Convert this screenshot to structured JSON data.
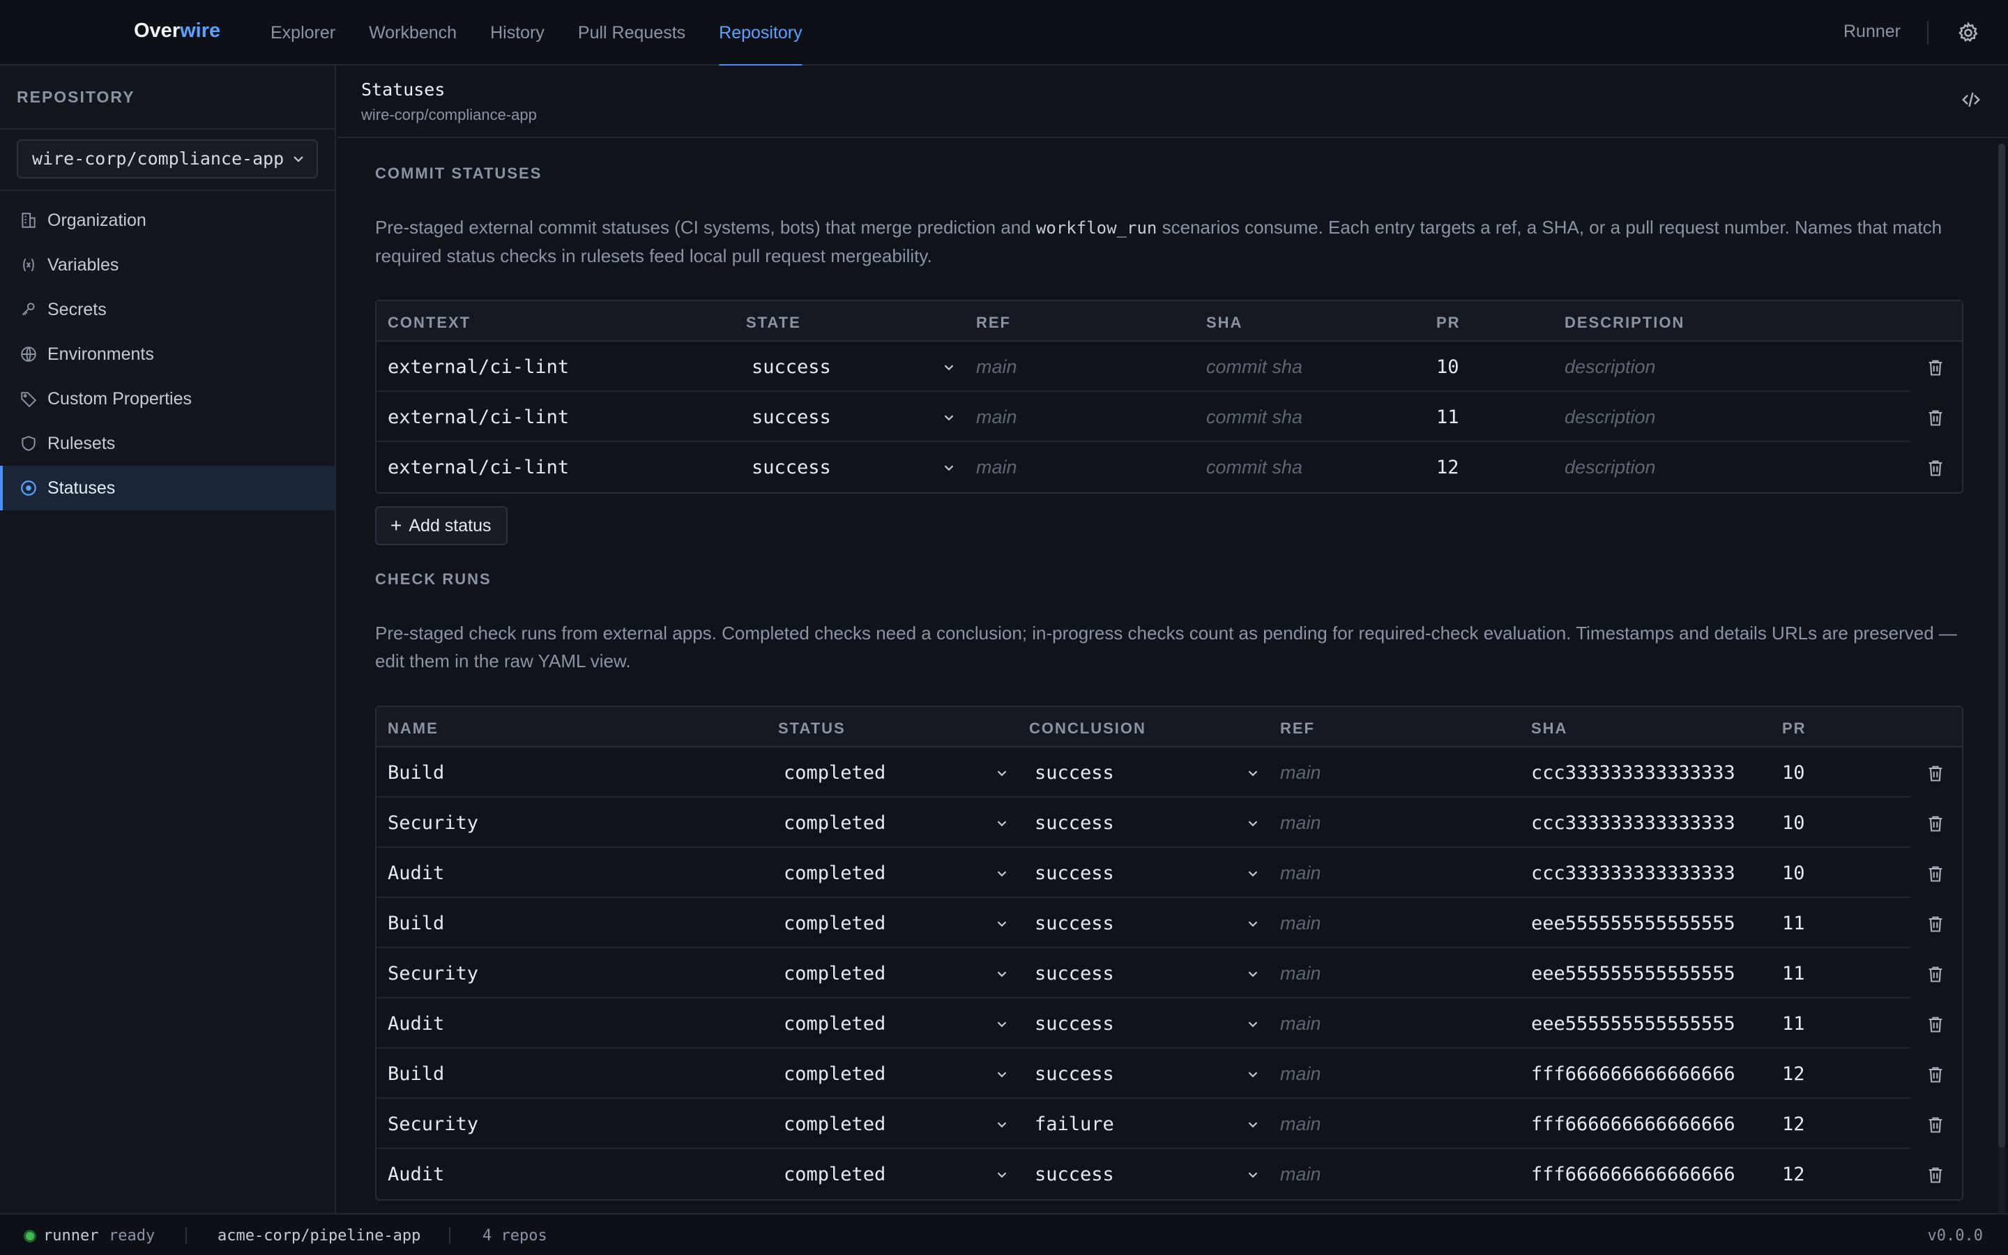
{
  "app": {
    "brand_part1": "Over",
    "brand_part2": "wire"
  },
  "nav": {
    "items": [
      "Explorer",
      "Workbench",
      "History",
      "Pull Requests",
      "Repository"
    ],
    "active": "Repository",
    "runner": "Runner"
  },
  "sidebar": {
    "heading": "REPOSITORY",
    "repo_select": "wire-corp/compliance-app",
    "items": [
      {
        "label": "Organization",
        "icon": "building-icon"
      },
      {
        "label": "Variables",
        "icon": "variable-icon"
      },
      {
        "label": "Secrets",
        "icon": "key-icon"
      },
      {
        "label": "Environments",
        "icon": "globe-icon"
      },
      {
        "label": "Custom Properties",
        "icon": "tag-icon"
      },
      {
        "label": "Rulesets",
        "icon": "shield-icon"
      },
      {
        "label": "Statuses",
        "icon": "status-circle-icon"
      }
    ],
    "active": "Statuses"
  },
  "page": {
    "title": "Statuses",
    "subtitle": "wire-corp/compliance-app"
  },
  "commit_statuses": {
    "title": "COMMIT STATUSES",
    "desc_pre": "Pre-staged external commit statuses (CI systems, bots) that merge prediction and ",
    "desc_code": "workflow_run",
    "desc_post": " scenarios consume. Each entry targets a ref, a SHA, or a pull request number. Names that match required status checks in rulesets feed local pull request mergeability.",
    "columns": [
      "CONTEXT",
      "STATE",
      "REF",
      "SHA",
      "PR",
      "DESCRIPTION"
    ],
    "rows": [
      {
        "context": "external/ci-lint",
        "state": "success",
        "ref": "main",
        "sha": "commit sha",
        "pr": "10",
        "description": "description"
      },
      {
        "context": "external/ci-lint",
        "state": "success",
        "ref": "main",
        "sha": "commit sha",
        "pr": "11",
        "description": "description"
      },
      {
        "context": "external/ci-lint",
        "state": "success",
        "ref": "main",
        "sha": "commit sha",
        "pr": "12",
        "description": "description"
      }
    ],
    "add_label": "Add status"
  },
  "check_runs": {
    "title": "CHECK RUNS",
    "desc": "Pre-staged check runs from external apps. Completed checks need a conclusion; in-progress checks count as pending for required-check evaluation. Timestamps and details URLs are preserved — edit them in the raw YAML view.",
    "columns": [
      "NAME",
      "STATUS",
      "CONCLUSION",
      "REF",
      "SHA",
      "PR"
    ],
    "rows": [
      {
        "name": "Build",
        "status": "completed",
        "conclusion": "success",
        "ref": "main",
        "sha": "ccc333333333333333",
        "pr": "10"
      },
      {
        "name": "Security",
        "status": "completed",
        "conclusion": "success",
        "ref": "main",
        "sha": "ccc333333333333333",
        "pr": "10"
      },
      {
        "name": "Audit",
        "status": "completed",
        "conclusion": "success",
        "ref": "main",
        "sha": "ccc333333333333333",
        "pr": "10"
      },
      {
        "name": "Build",
        "status": "completed",
        "conclusion": "success",
        "ref": "main",
        "sha": "eee555555555555555",
        "pr": "11"
      },
      {
        "name": "Security",
        "status": "completed",
        "conclusion": "success",
        "ref": "main",
        "sha": "eee555555555555555",
        "pr": "11"
      },
      {
        "name": "Audit",
        "status": "completed",
        "conclusion": "success",
        "ref": "main",
        "sha": "eee555555555555555",
        "pr": "11"
      },
      {
        "name": "Build",
        "status": "completed",
        "conclusion": "success",
        "ref": "main",
        "sha": "fff666666666666666",
        "pr": "12"
      },
      {
        "name": "Security",
        "status": "completed",
        "conclusion": "failure",
        "ref": "main",
        "sha": "fff666666666666666",
        "pr": "12"
      },
      {
        "name": "Audit",
        "status": "completed",
        "conclusion": "success",
        "ref": "main",
        "sha": "fff666666666666666",
        "pr": "12"
      }
    ]
  },
  "statusbar": {
    "runner_label": "runner",
    "runner_state": "ready",
    "repo": "acme-corp/pipeline-app",
    "repo_count": "4 repos",
    "version": "v0.0.0",
    "status_color": "#3fb950"
  },
  "colors": {
    "accent": "#5aa2ff",
    "background": "#0f131a"
  }
}
